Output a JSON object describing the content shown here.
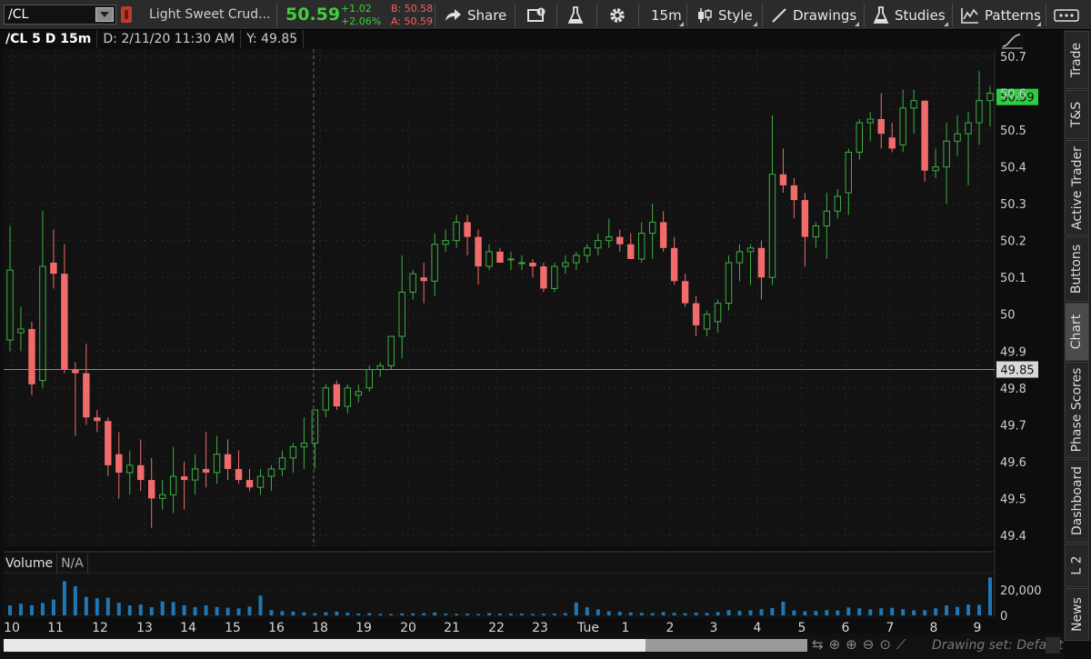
{
  "toolbar": {
    "symbol": "/CL",
    "description": "Light Sweet Crud...",
    "last": "50.59",
    "net_change": "+1.02",
    "pct_change": "+2.06%",
    "bid": "B: 50.58",
    "ask": "A: 50.59",
    "share_label": "Share",
    "timeframe_label": "15m",
    "style_label": "Style",
    "drawings_label": "Drawings",
    "studies_label": "Studies",
    "patterns_label": "Patterns"
  },
  "chart_header": {
    "symbol_period": "/CL 5 D 15m",
    "date": "D: 2/11/20 11:30 AM",
    "y": "Y: 49.85"
  },
  "volume_header": {
    "label": "Volume",
    "value": "N/A"
  },
  "side_tabs": [
    "Trade",
    "T&S",
    "Active Trader",
    "Buttons",
    "Chart",
    "Phase Scores",
    "Dashboard",
    "L 2",
    "News"
  ],
  "drawing_set": "Drawing set: Default",
  "colors": {
    "up": "#3cb043",
    "down": "#f26b6b",
    "price_tag": "#2ecc40"
  },
  "chart_data": {
    "type": "candlestick",
    "price_axis": {
      "ticks": [
        "50.7",
        "50.6",
        "50.5",
        "50.4",
        "50.3",
        "50.2",
        "50.1",
        "50",
        "49.9",
        "49.8",
        "49.7",
        "49.6",
        "49.5",
        "49.4"
      ],
      "range": [
        49.37,
        50.72
      ]
    },
    "last_price_tag": "50.59",
    "crosshair_price_tag": "49.85",
    "x_ticks": [
      "10",
      "11",
      "12",
      "13",
      "14",
      "15",
      "16",
      "18",
      "19",
      "20",
      "21",
      "22",
      "23",
      "Tue",
      "1",
      "2",
      "3",
      "4",
      "5",
      "6",
      "7",
      "8",
      "9"
    ],
    "volume_axis": {
      "ticks": [
        "20,000",
        "0"
      ],
      "range": [
        0,
        33000
      ]
    },
    "candles": [
      {
        "o": 49.93,
        "h": 50.24,
        "l": 49.9,
        "c": 50.12
      },
      {
        "o": 49.95,
        "h": 50.02,
        "l": 49.9,
        "c": 49.96
      },
      {
        "o": 49.96,
        "h": 49.98,
        "l": 49.78,
        "c": 49.81
      },
      {
        "o": 49.82,
        "h": 50.28,
        "l": 49.8,
        "c": 50.13
      },
      {
        "o": 50.14,
        "h": 50.23,
        "l": 50.07,
        "c": 50.11
      },
      {
        "o": 50.11,
        "h": 50.19,
        "l": 49.84,
        "c": 49.85
      },
      {
        "o": 49.85,
        "h": 49.87,
        "l": 49.67,
        "c": 49.84
      },
      {
        "o": 49.84,
        "h": 49.92,
        "l": 49.7,
        "c": 49.72
      },
      {
        "o": 49.72,
        "h": 49.74,
        "l": 49.68,
        "c": 49.71
      },
      {
        "o": 49.71,
        "h": 49.72,
        "l": 49.56,
        "c": 49.59
      },
      {
        "o": 49.62,
        "h": 49.68,
        "l": 49.5,
        "c": 49.57
      },
      {
        "o": 49.57,
        "h": 49.63,
        "l": 49.51,
        "c": 49.59
      },
      {
        "o": 49.59,
        "h": 49.66,
        "l": 49.52,
        "c": 49.55
      },
      {
        "o": 49.55,
        "h": 49.61,
        "l": 49.42,
        "c": 49.5
      },
      {
        "o": 49.5,
        "h": 49.55,
        "l": 49.47,
        "c": 49.51
      },
      {
        "o": 49.51,
        "h": 49.64,
        "l": 49.46,
        "c": 49.56
      },
      {
        "o": 49.56,
        "h": 49.6,
        "l": 49.47,
        "c": 49.55
      },
      {
        "o": 49.55,
        "h": 49.62,
        "l": 49.51,
        "c": 49.58
      },
      {
        "o": 49.58,
        "h": 49.68,
        "l": 49.53,
        "c": 49.57
      },
      {
        "o": 49.57,
        "h": 49.67,
        "l": 49.54,
        "c": 49.62
      },
      {
        "o": 49.62,
        "h": 49.66,
        "l": 49.55,
        "c": 49.58
      },
      {
        "o": 49.58,
        "h": 49.63,
        "l": 49.54,
        "c": 49.55
      },
      {
        "o": 49.55,
        "h": 49.58,
        "l": 49.52,
        "c": 49.53
      },
      {
        "o": 49.53,
        "h": 49.58,
        "l": 49.51,
        "c": 49.56
      },
      {
        "o": 49.56,
        "h": 49.59,
        "l": 49.52,
        "c": 49.58
      },
      {
        "o": 49.58,
        "h": 49.63,
        "l": 49.56,
        "c": 49.61
      },
      {
        "o": 49.61,
        "h": 49.65,
        "l": 49.57,
        "c": 49.64
      },
      {
        "o": 49.64,
        "h": 49.72,
        "l": 49.58,
        "c": 49.65
      },
      {
        "o": 49.65,
        "h": 49.74,
        "l": 49.58,
        "c": 49.74
      },
      {
        "o": 49.74,
        "h": 49.81,
        "l": 49.72,
        "c": 49.8
      },
      {
        "o": 49.81,
        "h": 49.82,
        "l": 49.74,
        "c": 49.75
      },
      {
        "o": 49.75,
        "h": 49.81,
        "l": 49.73,
        "c": 49.8
      },
      {
        "o": 49.78,
        "h": 49.81,
        "l": 49.76,
        "c": 49.79
      },
      {
        "o": 49.8,
        "h": 49.86,
        "l": 49.79,
        "c": 49.85
      },
      {
        "o": 49.85,
        "h": 49.87,
        "l": 49.83,
        "c": 49.86
      },
      {
        "o": 49.86,
        "h": 49.92,
        "l": 49.85,
        "c": 49.94
      },
      {
        "o": 49.94,
        "h": 50.16,
        "l": 49.88,
        "c": 50.06
      },
      {
        "o": 50.06,
        "h": 50.12,
        "l": 50.04,
        "c": 50.11
      },
      {
        "o": 50.1,
        "h": 50.14,
        "l": 50.03,
        "c": 50.09
      },
      {
        "o": 50.09,
        "h": 50.22,
        "l": 50.05,
        "c": 50.19
      },
      {
        "o": 50.19,
        "h": 50.23,
        "l": 50.17,
        "c": 50.2
      },
      {
        "o": 50.2,
        "h": 50.27,
        "l": 50.18,
        "c": 50.25
      },
      {
        "o": 50.25,
        "h": 50.27,
        "l": 50.16,
        "c": 50.21
      },
      {
        "o": 50.21,
        "h": 50.23,
        "l": 50.08,
        "c": 50.13
      },
      {
        "o": 50.13,
        "h": 50.19,
        "l": 50.12,
        "c": 50.17
      },
      {
        "o": 50.17,
        "h": 50.18,
        "l": 50.14,
        "c": 50.14
      },
      {
        "o": 50.15,
        "h": 50.17,
        "l": 50.12,
        "c": 50.15
      },
      {
        "o": 50.14,
        "h": 50.16,
        "l": 50.12,
        "c": 50.14
      },
      {
        "o": 50.14,
        "h": 50.15,
        "l": 50.1,
        "c": 50.13
      },
      {
        "o": 50.13,
        "h": 50.14,
        "l": 50.06,
        "c": 50.07
      },
      {
        "o": 50.07,
        "h": 50.14,
        "l": 50.06,
        "c": 50.13
      },
      {
        "o": 50.13,
        "h": 50.16,
        "l": 50.11,
        "c": 50.14
      },
      {
        "o": 50.14,
        "h": 50.17,
        "l": 50.12,
        "c": 50.16
      },
      {
        "o": 50.16,
        "h": 50.19,
        "l": 50.14,
        "c": 50.18
      },
      {
        "o": 50.18,
        "h": 50.22,
        "l": 50.16,
        "c": 50.2
      },
      {
        "o": 50.2,
        "h": 50.26,
        "l": 50.18,
        "c": 50.21
      },
      {
        "o": 50.21,
        "h": 50.23,
        "l": 50.17,
        "c": 50.19
      },
      {
        "o": 50.19,
        "h": 50.22,
        "l": 50.15,
        "c": 50.15
      },
      {
        "o": 50.15,
        "h": 50.25,
        "l": 50.14,
        "c": 50.22
      },
      {
        "o": 50.22,
        "h": 50.3,
        "l": 50.15,
        "c": 50.25
      },
      {
        "o": 50.25,
        "h": 50.28,
        "l": 50.17,
        "c": 50.18
      },
      {
        "o": 50.18,
        "h": 50.21,
        "l": 50.08,
        "c": 50.09
      },
      {
        "o": 50.09,
        "h": 50.11,
        "l": 50.02,
        "c": 50.03
      },
      {
        "o": 50.03,
        "h": 50.05,
        "l": 49.94,
        "c": 49.97
      },
      {
        "o": 49.96,
        "h": 50.01,
        "l": 49.94,
        "c": 50.0
      },
      {
        "o": 49.98,
        "h": 50.04,
        "l": 49.95,
        "c": 50.03
      },
      {
        "o": 50.03,
        "h": 50.16,
        "l": 50.01,
        "c": 50.14
      },
      {
        "o": 50.14,
        "h": 50.19,
        "l": 50.09,
        "c": 50.17
      },
      {
        "o": 50.17,
        "h": 50.19,
        "l": 50.08,
        "c": 50.18
      },
      {
        "o": 50.18,
        "h": 50.2,
        "l": 50.04,
        "c": 50.1
      },
      {
        "o": 50.1,
        "h": 50.54,
        "l": 50.08,
        "c": 50.38
      },
      {
        "o": 50.38,
        "h": 50.45,
        "l": 50.33,
        "c": 50.35
      },
      {
        "o": 50.35,
        "h": 50.37,
        "l": 50.26,
        "c": 50.31
      },
      {
        "o": 50.31,
        "h": 50.33,
        "l": 50.13,
        "c": 50.21
      },
      {
        "o": 50.21,
        "h": 50.25,
        "l": 50.18,
        "c": 50.24
      },
      {
        "o": 50.24,
        "h": 50.33,
        "l": 50.15,
        "c": 50.28
      },
      {
        "o": 50.28,
        "h": 50.34,
        "l": 50.26,
        "c": 50.32
      },
      {
        "o": 50.33,
        "h": 50.45,
        "l": 50.27,
        "c": 50.44
      },
      {
        "o": 50.44,
        "h": 50.53,
        "l": 50.42,
        "c": 50.52
      },
      {
        "o": 50.52,
        "h": 50.55,
        "l": 50.47,
        "c": 50.53
      },
      {
        "o": 50.53,
        "h": 50.6,
        "l": 50.45,
        "c": 50.49
      },
      {
        "o": 50.48,
        "h": 50.52,
        "l": 50.44,
        "c": 50.45
      },
      {
        "o": 50.46,
        "h": 50.61,
        "l": 50.44,
        "c": 50.56
      },
      {
        "o": 50.56,
        "h": 50.61,
        "l": 50.49,
        "c": 50.58
      },
      {
        "o": 50.58,
        "h": 50.58,
        "l": 50.36,
        "c": 50.39
      },
      {
        "o": 50.39,
        "h": 50.45,
        "l": 50.37,
        "c": 50.4
      },
      {
        "o": 50.4,
        "h": 50.52,
        "l": 50.3,
        "c": 50.47
      },
      {
        "o": 50.47,
        "h": 50.54,
        "l": 50.43,
        "c": 50.49
      },
      {
        "o": 50.49,
        "h": 50.55,
        "l": 50.35,
        "c": 50.52
      },
      {
        "o": 50.52,
        "h": 50.66,
        "l": 50.46,
        "c": 50.58
      },
      {
        "o": 50.58,
        "h": 50.62,
        "l": 50.51,
        "c": 50.6
      }
    ],
    "volumes": [
      7800,
      9200,
      8000,
      9800,
      12500,
      27000,
      23000,
      14600,
      13500,
      14000,
      10000,
      7800,
      8500,
      6500,
      11000,
      10500,
      8000,
      6500,
      7800,
      6600,
      6000,
      5500,
      6900,
      15600,
      4200,
      3400,
      3000,
      2400,
      1800,
      2500,
      3000,
      2100,
      1500,
      1800,
      1200,
      1100,
      1600,
      1500,
      1700,
      2300,
      1400,
      1200,
      1300,
      1100,
      1800,
      1500,
      1400,
      1300,
      1200,
      1300,
      1500,
      1800,
      10200,
      6400,
      4700,
      3300,
      2900,
      2300,
      2000,
      1800,
      2600,
      2000,
      1700,
      2100,
      1900,
      2600,
      4100,
      3500,
      4000,
      4900,
      5800,
      10800,
      3900,
      3200,
      3500,
      4100,
      3900,
      6200,
      5600,
      4800,
      5600,
      5900,
      4800,
      4000,
      4000,
      5600,
      7800,
      6700,
      8500,
      8300,
      30000
    ]
  }
}
